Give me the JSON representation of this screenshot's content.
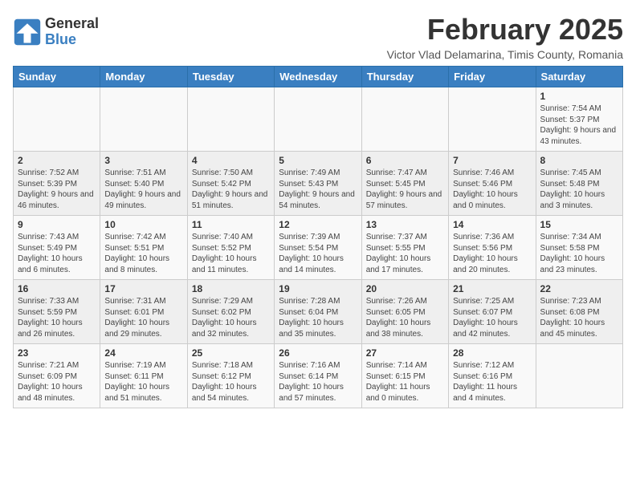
{
  "header": {
    "logo_general": "General",
    "logo_blue": "Blue",
    "month_year": "February 2025",
    "location": "Victor Vlad Delamarina, Timis County, Romania"
  },
  "weekdays": [
    "Sunday",
    "Monday",
    "Tuesday",
    "Wednesday",
    "Thursday",
    "Friday",
    "Saturday"
  ],
  "weeks": [
    [
      {
        "day": "",
        "info": ""
      },
      {
        "day": "",
        "info": ""
      },
      {
        "day": "",
        "info": ""
      },
      {
        "day": "",
        "info": ""
      },
      {
        "day": "",
        "info": ""
      },
      {
        "day": "",
        "info": ""
      },
      {
        "day": "1",
        "info": "Sunrise: 7:54 AM\nSunset: 5:37 PM\nDaylight: 9 hours and 43 minutes."
      }
    ],
    [
      {
        "day": "2",
        "info": "Sunrise: 7:52 AM\nSunset: 5:39 PM\nDaylight: 9 hours and 46 minutes."
      },
      {
        "day": "3",
        "info": "Sunrise: 7:51 AM\nSunset: 5:40 PM\nDaylight: 9 hours and 49 minutes."
      },
      {
        "day": "4",
        "info": "Sunrise: 7:50 AM\nSunset: 5:42 PM\nDaylight: 9 hours and 51 minutes."
      },
      {
        "day": "5",
        "info": "Sunrise: 7:49 AM\nSunset: 5:43 PM\nDaylight: 9 hours and 54 minutes."
      },
      {
        "day": "6",
        "info": "Sunrise: 7:47 AM\nSunset: 5:45 PM\nDaylight: 9 hours and 57 minutes."
      },
      {
        "day": "7",
        "info": "Sunrise: 7:46 AM\nSunset: 5:46 PM\nDaylight: 10 hours and 0 minutes."
      },
      {
        "day": "8",
        "info": "Sunrise: 7:45 AM\nSunset: 5:48 PM\nDaylight: 10 hours and 3 minutes."
      }
    ],
    [
      {
        "day": "9",
        "info": "Sunrise: 7:43 AM\nSunset: 5:49 PM\nDaylight: 10 hours and 6 minutes."
      },
      {
        "day": "10",
        "info": "Sunrise: 7:42 AM\nSunset: 5:51 PM\nDaylight: 10 hours and 8 minutes."
      },
      {
        "day": "11",
        "info": "Sunrise: 7:40 AM\nSunset: 5:52 PM\nDaylight: 10 hours and 11 minutes."
      },
      {
        "day": "12",
        "info": "Sunrise: 7:39 AM\nSunset: 5:54 PM\nDaylight: 10 hours and 14 minutes."
      },
      {
        "day": "13",
        "info": "Sunrise: 7:37 AM\nSunset: 5:55 PM\nDaylight: 10 hours and 17 minutes."
      },
      {
        "day": "14",
        "info": "Sunrise: 7:36 AM\nSunset: 5:56 PM\nDaylight: 10 hours and 20 minutes."
      },
      {
        "day": "15",
        "info": "Sunrise: 7:34 AM\nSunset: 5:58 PM\nDaylight: 10 hours and 23 minutes."
      }
    ],
    [
      {
        "day": "16",
        "info": "Sunrise: 7:33 AM\nSunset: 5:59 PM\nDaylight: 10 hours and 26 minutes."
      },
      {
        "day": "17",
        "info": "Sunrise: 7:31 AM\nSunset: 6:01 PM\nDaylight: 10 hours and 29 minutes."
      },
      {
        "day": "18",
        "info": "Sunrise: 7:29 AM\nSunset: 6:02 PM\nDaylight: 10 hours and 32 minutes."
      },
      {
        "day": "19",
        "info": "Sunrise: 7:28 AM\nSunset: 6:04 PM\nDaylight: 10 hours and 35 minutes."
      },
      {
        "day": "20",
        "info": "Sunrise: 7:26 AM\nSunset: 6:05 PM\nDaylight: 10 hours and 38 minutes."
      },
      {
        "day": "21",
        "info": "Sunrise: 7:25 AM\nSunset: 6:07 PM\nDaylight: 10 hours and 42 minutes."
      },
      {
        "day": "22",
        "info": "Sunrise: 7:23 AM\nSunset: 6:08 PM\nDaylight: 10 hours and 45 minutes."
      }
    ],
    [
      {
        "day": "23",
        "info": "Sunrise: 7:21 AM\nSunset: 6:09 PM\nDaylight: 10 hours and 48 minutes."
      },
      {
        "day": "24",
        "info": "Sunrise: 7:19 AM\nSunset: 6:11 PM\nDaylight: 10 hours and 51 minutes."
      },
      {
        "day": "25",
        "info": "Sunrise: 7:18 AM\nSunset: 6:12 PM\nDaylight: 10 hours and 54 minutes."
      },
      {
        "day": "26",
        "info": "Sunrise: 7:16 AM\nSunset: 6:14 PM\nDaylight: 10 hours and 57 minutes."
      },
      {
        "day": "27",
        "info": "Sunrise: 7:14 AM\nSunset: 6:15 PM\nDaylight: 11 hours and 0 minutes."
      },
      {
        "day": "28",
        "info": "Sunrise: 7:12 AM\nSunset: 6:16 PM\nDaylight: 11 hours and 4 minutes."
      },
      {
        "day": "",
        "info": ""
      }
    ]
  ]
}
